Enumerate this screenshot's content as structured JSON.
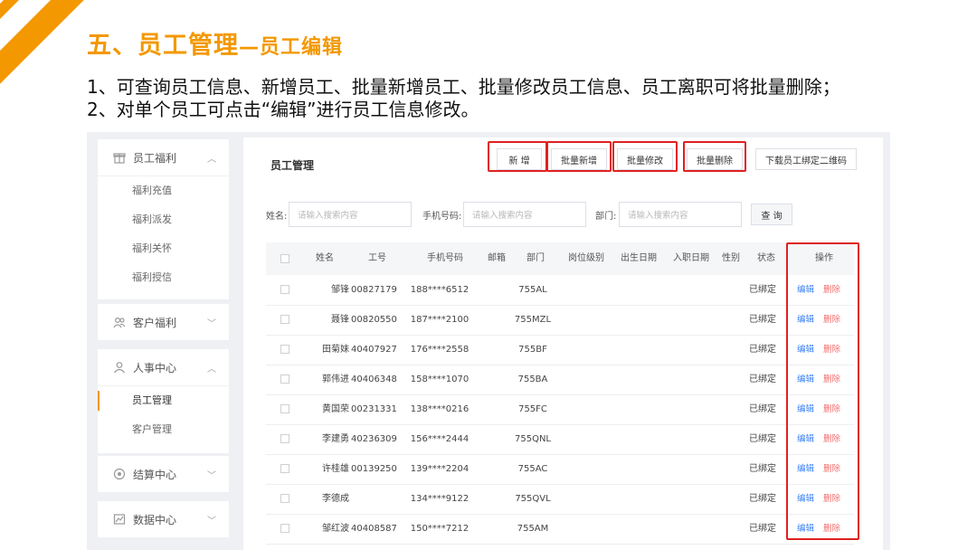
{
  "slide": {
    "title": "五、员工管理",
    "title_sub": "—员工编辑",
    "desc_line1": "1、可查询员工信息、新增员工、批量新增员工、批量修改员工信息、员工离职可将批量删除；",
    "desc_line2": "2、对单个员工可点击“编辑”进行员工信息修改。",
    "accent_color": "#f39800",
    "highlight_color": "#e02020"
  },
  "sidebar": {
    "welfare": {
      "label": "员工福利",
      "icon": "gift-icon",
      "items": [
        "福利充值",
        "福利派发",
        "福利关怀",
        "福利授信"
      ]
    },
    "customer_welfare": {
      "label": "客户福利",
      "icon": "people-icon"
    },
    "hr": {
      "label": "人事中心",
      "icon": "person-icon",
      "items": [
        "员工管理",
        "客户管理"
      ],
      "active": "员工管理"
    },
    "settlement": {
      "label": "结算中心",
      "icon": "coin-icon"
    },
    "data": {
      "label": "数据中心",
      "icon": "chart-icon"
    }
  },
  "main": {
    "title": "员工管理",
    "buttons": {
      "add": "新 增",
      "batch_add": "批量新增",
      "batch_edit": "批量修改",
      "batch_delete": "批量删除",
      "download_qr": "下载员工绑定二维码"
    },
    "filters": {
      "name_label": "姓名:",
      "name_placeholder": "请输入搜索内容",
      "phone_label": "手机号码:",
      "phone_placeholder": "请输入搜索内容",
      "dept_label": "部门:",
      "dept_placeholder": "请输入搜索内容",
      "search_button": "查 询"
    },
    "table": {
      "headers": {
        "name": "姓名",
        "id": "工号",
        "phone": "手机号码",
        "email": "邮箱",
        "dept": "部门",
        "level": "岗位级别",
        "birth": "出生日期",
        "join": "入职日期",
        "gender": "性别",
        "status": "状态",
        "ops": "操作"
      },
      "edit_label": "编辑",
      "delete_label": "删除",
      "rows": [
        {
          "name": "邹锋",
          "id": "00827179",
          "phone": "188****6512",
          "dept": "755AL",
          "status": "已绑定"
        },
        {
          "name": "聂锋",
          "id": "00820550",
          "phone": "187****2100",
          "dept": "755MZL",
          "status": "已绑定"
        },
        {
          "name": "田菊妹",
          "id": "40407927",
          "phone": "176****2558",
          "dept": "755BF",
          "status": "已绑定"
        },
        {
          "name": "郭伟进",
          "id": "40406348",
          "phone": "158****1070",
          "dept": "755BA",
          "status": "已绑定"
        },
        {
          "name": "黄国荣",
          "id": "00231331",
          "phone": "138****0216",
          "dept": "755FC",
          "status": "已绑定"
        },
        {
          "name": "李建勇",
          "id": "40236309",
          "phone": "156****2444",
          "dept": "755QNL",
          "status": "已绑定"
        },
        {
          "name": "许桂雄",
          "id": "00139250",
          "phone": "139****2204",
          "dept": "755AC",
          "status": "已绑定"
        },
        {
          "name": "李德成",
          "id": "",
          "phone": "134****9122",
          "dept": "755QVL",
          "status": "已绑定"
        },
        {
          "name": "邹红波",
          "id": "40408587",
          "phone": "150****7212",
          "dept": "755AM",
          "status": "已绑定"
        }
      ]
    }
  }
}
